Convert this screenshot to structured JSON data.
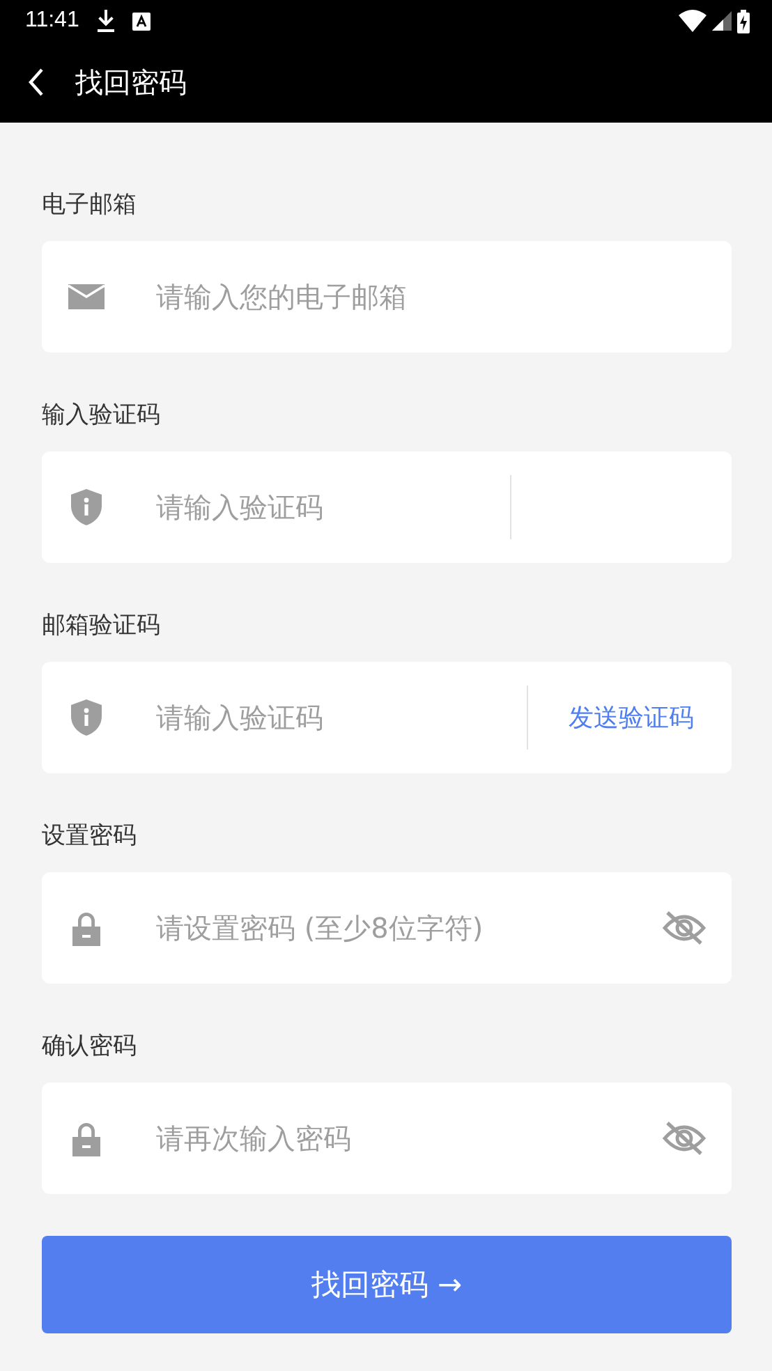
{
  "status_bar": {
    "time": "11:41"
  },
  "app_bar": {
    "title": "找回密码"
  },
  "fields": [
    {
      "kind": "email",
      "label": "电子邮箱",
      "placeholder": "请输入您的电子邮箱"
    },
    {
      "kind": "captcha",
      "label": "输入验证码",
      "placeholder": "请输入验证码"
    },
    {
      "kind": "code",
      "label": "邮箱验证码",
      "placeholder": "请输入验证码",
      "link": "发送验证码"
    },
    {
      "kind": "password",
      "label": "设置密码",
      "placeholder": "请设置密码 (至少8位字符)"
    },
    {
      "kind": "password",
      "label": "确认密码",
      "placeholder": "请再次输入密码"
    }
  ],
  "submit": {
    "label": "找回密码 →"
  }
}
